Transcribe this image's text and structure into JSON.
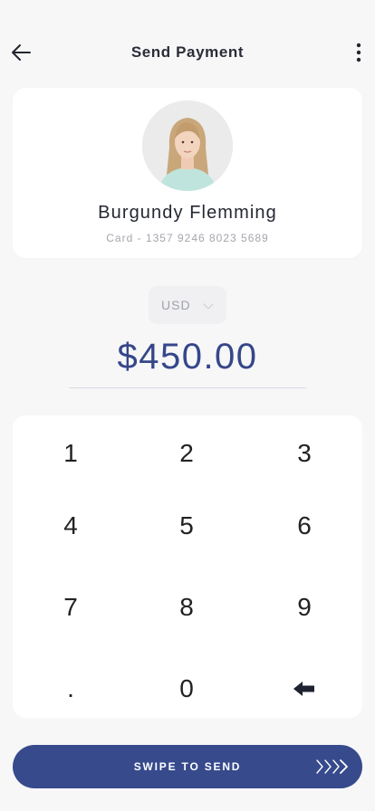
{
  "header": {
    "title": "Send Payment"
  },
  "recipient": {
    "name": "Burgundy Flemming",
    "card": "Card - 1357 9246 8023 5689"
  },
  "currency": {
    "selected": "USD"
  },
  "amount": "$450.00",
  "keypad": {
    "keys": [
      "1",
      "2",
      "3",
      "4",
      "5",
      "6",
      "7",
      "8",
      "9",
      ".",
      "0",
      "backspace"
    ]
  },
  "swipe": {
    "label": "SWIPE TO SEND"
  }
}
